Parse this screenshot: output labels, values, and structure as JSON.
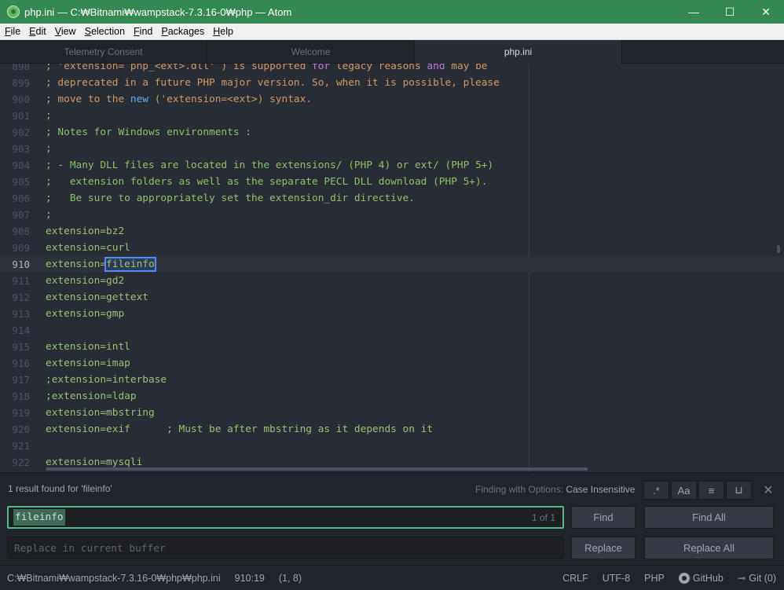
{
  "window": {
    "title": "php.ini — C:₩Bitnami₩wampstack-7.3.16-0₩php — Atom",
    "minimize": "—",
    "maximize": "☐",
    "close": "✕"
  },
  "menu": [
    {
      "label": "File",
      "u": "F",
      "rest": "ile"
    },
    {
      "label": "Edit",
      "u": "E",
      "rest": "dit"
    },
    {
      "label": "View",
      "u": "V",
      "rest": "iew"
    },
    {
      "label": "Selection",
      "u": "S",
      "rest": "election"
    },
    {
      "label": "Find",
      "u": "F",
      "rest": "ind"
    },
    {
      "label": "Packages",
      "u": "P",
      "rest": "ackages"
    },
    {
      "label": "Help",
      "u": "H",
      "rest": "elp"
    }
  ],
  "tabs": [
    "Telemetry Consent",
    "Welcome",
    "php.ini"
  ],
  "editor": {
    "lines": [
      {
        "n": "898",
        "segs": [
          [
            ";",
            "c"
          ],
          [
            " 'extension= php_<ext>.dll' ) is supported ",
            "o"
          ],
          [
            "for",
            "p"
          ],
          [
            " legacy reasons ",
            "o"
          ],
          [
            "and",
            "p"
          ],
          [
            " may be",
            "o"
          ]
        ]
      },
      {
        "n": "899",
        "segs": [
          [
            ";",
            "c"
          ],
          [
            " deprecated in a future PHP major version. So, when it is possible, please",
            "o"
          ]
        ]
      },
      {
        "n": "900",
        "segs": [
          [
            ";",
            "c"
          ],
          [
            " move to the ",
            "o"
          ],
          [
            "new",
            "b"
          ],
          [
            " ('extension=<ext>) syntax.",
            "o"
          ]
        ]
      },
      {
        "n": "901",
        "segs": [
          [
            ";",
            "c"
          ]
        ]
      },
      {
        "n": "902",
        "segs": [
          [
            "; Notes for Windows environments :",
            "c"
          ]
        ]
      },
      {
        "n": "903",
        "segs": [
          [
            ";",
            "c"
          ]
        ]
      },
      {
        "n": "904",
        "segs": [
          [
            "; - Many DLL files are located in the extensions/ (PHP 4) or ext/ (PHP 5+)",
            "c"
          ]
        ]
      },
      {
        "n": "905",
        "segs": [
          [
            ";   extension folders as well as the separate PECL DLL download (PHP 5+).",
            "c"
          ]
        ]
      },
      {
        "n": "906",
        "segs": [
          [
            ";   Be sure to appropriately set the extension_dir directive.",
            "c"
          ]
        ]
      },
      {
        "n": "907",
        "segs": [
          [
            ";",
            "c"
          ]
        ]
      },
      {
        "n": "908",
        "segs": [
          [
            "extension=bz2",
            "t"
          ]
        ]
      },
      {
        "n": "909",
        "segs": [
          [
            "extension=curl",
            "t"
          ]
        ]
      },
      {
        "n": "910",
        "segs": [
          [
            "extension=",
            "t"
          ],
          [
            "fileinfo",
            "s"
          ]
        ],
        "current": true
      },
      {
        "n": "911",
        "segs": [
          [
            "extension=gd2",
            "t"
          ]
        ]
      },
      {
        "n": "912",
        "segs": [
          [
            "extension=gettext",
            "t"
          ]
        ]
      },
      {
        "n": "913",
        "segs": [
          [
            "extension=gmp",
            "t"
          ]
        ]
      },
      {
        "n": "914",
        "segs": []
      },
      {
        "n": "915",
        "segs": [
          [
            "extension=intl",
            "t"
          ]
        ]
      },
      {
        "n": "916",
        "segs": [
          [
            "extension=imap",
            "t"
          ]
        ]
      },
      {
        "n": "917",
        "segs": [
          [
            ";extension=interbase",
            "t"
          ]
        ]
      },
      {
        "n": "918",
        "segs": [
          [
            ";extension=ldap",
            "t"
          ]
        ]
      },
      {
        "n": "919",
        "segs": [
          [
            "extension=mbstring",
            "t"
          ]
        ]
      },
      {
        "n": "920",
        "segs": [
          [
            "extension=exif      ; Must be after mbstring as it depends on it",
            "t"
          ]
        ]
      },
      {
        "n": "921",
        "segs": []
      },
      {
        "n": "922",
        "segs": [
          [
            "extension=mysqli",
            "t"
          ]
        ]
      }
    ]
  },
  "find": {
    "description": "1 result found for 'fileinfo'",
    "options_label": "Finding with Options:",
    "options_value": "Case Insensitive",
    "option_buttons": [
      {
        "name": "regex-toggle",
        "glyph": ".*"
      },
      {
        "name": "case-sensitive-toggle",
        "glyph": "Aa"
      },
      {
        "name": "in-selection-toggle",
        "glyph": "≡"
      },
      {
        "name": "whole-word-toggle",
        "glyph": "⊔"
      }
    ],
    "close": "✕",
    "query": "fileinfo",
    "count": "1 of 1",
    "replace_placeholder": "Replace in current buffer",
    "find_label": "Find",
    "find_all_label": "Find All",
    "replace_label": "Replace",
    "replace_all_label": "Replace All"
  },
  "status": {
    "path": "C:₩Bitnami₩wampstack-7.3.16-0₩php₩php.ini",
    "cursor": "910:19",
    "selection": "(1, 8)",
    "line_ending": "CRLF",
    "encoding": "UTF-8",
    "grammar": "PHP",
    "github": "GitHub",
    "git": "Git (0)"
  }
}
